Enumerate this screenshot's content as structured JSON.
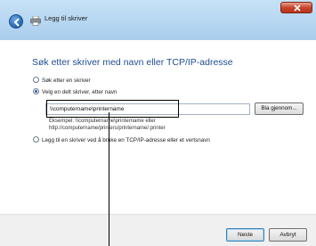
{
  "window": {
    "title": "Legg til skriver",
    "icons": [
      "back-arrow-icon",
      "printer-icon",
      "close-icon"
    ]
  },
  "page": {
    "heading": "Søk etter skriver med navn eller TCP/IP-adresse"
  },
  "options": [
    {
      "label": "Søk etter en skriver",
      "selected": false
    },
    {
      "label": "Velg en delt skriver, etter navn",
      "selected": true
    },
    {
      "label": "Legg til en skriver ved å bruke en TCP/IP-adresse eller et vertsnavn",
      "selected": false
    }
  ],
  "share_path": {
    "value": "\\\\computername\\printername",
    "browse_label": "Bla gjennom..."
  },
  "example": {
    "line1": "Eksempel: \\\\computername\\printername eller",
    "line2": "http://computername/printers/printername/.printer"
  },
  "footer": {
    "next_label": "Neste",
    "cancel_label": "Avbryt"
  },
  "colors": {
    "titlebar": "#b9d8f2",
    "heading": "#1e4d8f",
    "close": "#c8452e"
  }
}
